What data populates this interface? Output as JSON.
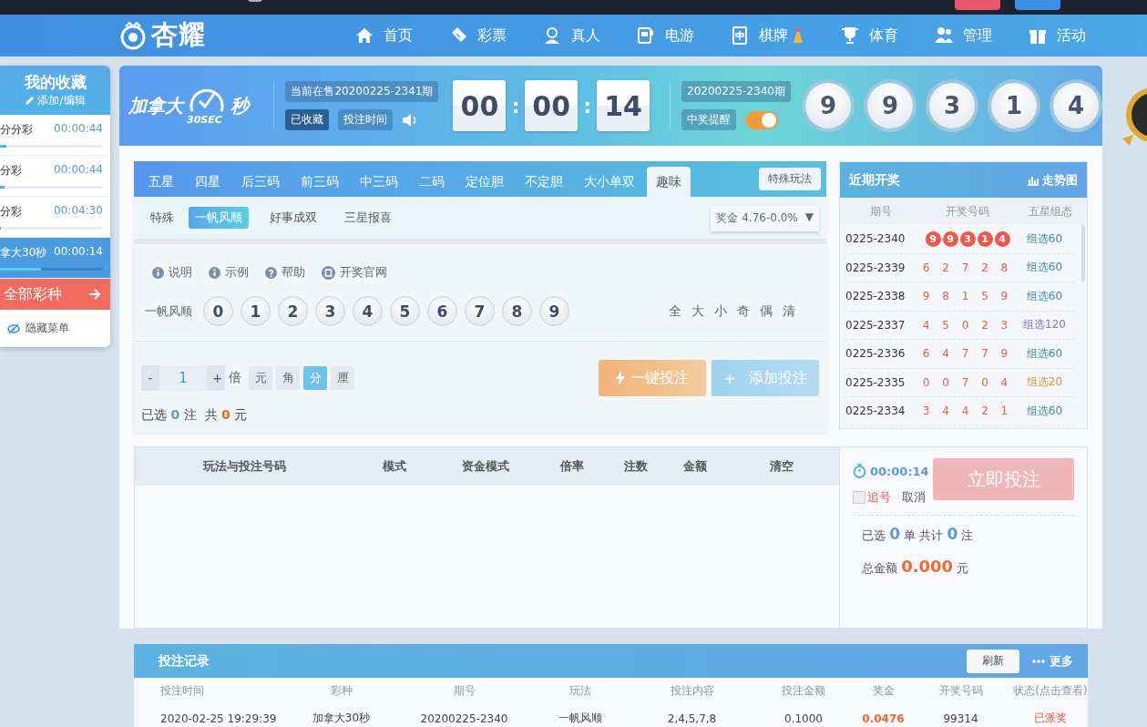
{
  "top_bar": {
    "buttons": [
      {
        "color": "#e8566b"
      },
      {
        "color": "#3a8fe6"
      }
    ]
  },
  "nav": {
    "logo": "杏耀",
    "items": [
      {
        "label": "首页"
      },
      {
        "label": "彩票"
      },
      {
        "label": "真人"
      },
      {
        "label": "电游"
      },
      {
        "label": "棋牌"
      },
      {
        "label": "体育"
      },
      {
        "label": "管理"
      },
      {
        "label": "活动"
      }
    ]
  },
  "favorites": {
    "title": "我的收藏",
    "edit": "添加/编辑",
    "items": [
      {
        "name": "分分彩",
        "time": "00:00:44",
        "level": 0.06,
        "selected": false
      },
      {
        "name": "分彩",
        "time": "00:00:44",
        "level": 0.04,
        "selected": false
      },
      {
        "name": "分彩",
        "time": "00:04:30",
        "level": 0.01,
        "selected": false
      },
      {
        "name": "拿大30秒",
        "time": "00:00:14",
        "level": 0.4,
        "selected": true
      }
    ],
    "all_lotteries": "全部彩种",
    "hide_menu": "隐藏菜单"
  },
  "lottery": {
    "name_left": "加拿大",
    "clock_text": "30SEC",
    "name_right": "秒",
    "current_issue": "当前在售20200225-2341期",
    "favorited": "已收藏",
    "bet_time": "投注时间",
    "countdown": [
      "00",
      "00",
      "14"
    ],
    "separators": [
      ":",
      ":"
    ],
    "last_issue": "20200225-2340期",
    "win_alert": {
      "label": "中奖提醒",
      "on": true
    },
    "result": [
      "9",
      "9",
      "3",
      "1",
      "4"
    ]
  },
  "play": {
    "tabs": [
      {
        "label": "五星",
        "selected": false
      },
      {
        "label": "四星",
        "selected": false
      },
      {
        "label": "后三码",
        "selected": false
      },
      {
        "label": "前三码",
        "selected": false
      },
      {
        "label": "中三码",
        "selected": false
      },
      {
        "label": "二码",
        "selected": false
      },
      {
        "label": "定位胆",
        "selected": false
      },
      {
        "label": "不定胆",
        "selected": false
      },
      {
        "label": "大小单双",
        "selected": false
      },
      {
        "label": "趣味",
        "selected": true
      }
    ],
    "special_play": "特殊玩法",
    "group_label": "特殊",
    "sub_tabs": [
      {
        "label": "一帆风顺",
        "selected": true
      },
      {
        "label": "好事成双",
        "selected": false
      },
      {
        "label": "三星报喜",
        "selected": false
      }
    ],
    "prize": "奖金 4.76-0.0%",
    "prize_caret": "▼",
    "help_links": [
      "说明",
      "示例",
      "帮助",
      "开奖官网"
    ],
    "row_label": "一帆风顺",
    "numbers": [
      {
        "label": "0",
        "selected": false
      },
      {
        "label": "1",
        "selected": false
      },
      {
        "label": "2",
        "selected": false
      },
      {
        "label": "3",
        "selected": false
      },
      {
        "label": "4",
        "selected": false
      },
      {
        "label": "5",
        "selected": false
      },
      {
        "label": "6",
        "selected": false
      },
      {
        "label": "7",
        "selected": false
      },
      {
        "label": "8",
        "selected": false
      },
      {
        "label": "9",
        "selected": false
      }
    ],
    "quick_picks": [
      "全",
      "大",
      "小",
      "奇",
      "偶",
      "清"
    ],
    "multiplier": {
      "minus": "-",
      "value": "1",
      "plus": "+",
      "unit": "倍"
    },
    "units": [
      {
        "label": "元",
        "selected": false
      },
      {
        "label": "角",
        "selected": false
      },
      {
        "label": "分",
        "selected": true
      },
      {
        "label": "厘",
        "selected": false
      }
    ],
    "summary": {
      "selected_label": "已选",
      "count": "0",
      "count_unit": "注",
      "total_label": "共",
      "amount": "0",
      "amount_unit": "元"
    },
    "quick_bet": "一键投注",
    "add_bet": {
      "symbol": "+",
      "label": "添加投注"
    }
  },
  "recent_draws": {
    "title": "近期开奖",
    "trend": "走势图",
    "columns": [
      "期号",
      "开奖号码",
      "五星组态"
    ],
    "rows": [
      {
        "period": "0225-2340",
        "numbers": [
          "9",
          "9",
          "3",
          "1",
          "4"
        ],
        "latest": true,
        "pattern": "组选60",
        "color": "#3b8fa3"
      },
      {
        "period": "0225-2339",
        "numbers": [
          "6",
          "2",
          "7",
          "2",
          "8"
        ],
        "latest": false,
        "pattern": "组选60",
        "color": "#3b8fa3"
      },
      {
        "period": "0225-2338",
        "numbers": [
          "9",
          "8",
          "1",
          "5",
          "9"
        ],
        "latest": false,
        "pattern": "组选60",
        "color": "#3b8fa3"
      },
      {
        "period": "0225-2337",
        "numbers": [
          "4",
          "5",
          "0",
          "2",
          "3"
        ],
        "latest": false,
        "pattern": "组选120",
        "color": "#8b6fd0"
      },
      {
        "period": "0225-2336",
        "numbers": [
          "6",
          "4",
          "7",
          "7",
          "9"
        ],
        "latest": false,
        "pattern": "组选60",
        "color": "#3b8fa3"
      },
      {
        "period": "0225-2335",
        "numbers": [
          "0",
          "0",
          "7",
          "0",
          "4"
        ],
        "latest": false,
        "pattern": "组选20",
        "color": "#c9962e"
      },
      {
        "period": "0225-2334",
        "numbers": [
          "3",
          "4",
          "4",
          "2",
          "1"
        ],
        "latest": false,
        "pattern": "组选60",
        "color": "#3b8fa3"
      }
    ]
  },
  "bet_list": {
    "columns": [
      "玩法与投注号码",
      "模式",
      "资金模式",
      "倍率",
      "注数",
      "金额",
      "清空"
    ],
    "timer": "00:00:14",
    "submit": "立即投注",
    "submit_disabled": true,
    "chase": {
      "label": "追号",
      "checked": false
    },
    "cancel": "取消",
    "summary": {
      "orders_label": "已选",
      "orders": "0",
      "orders_unit": "单",
      "count_label": "共计",
      "count": "0",
      "count_unit": "注",
      "total_label": "总金额",
      "total": "0.000",
      "total_unit": "元"
    }
  },
  "records": {
    "title": "投注记录",
    "refresh": "刷新",
    "more": "更多",
    "columns": [
      "投注时间",
      "彩种",
      "期号",
      "玩法",
      "投注内容",
      "投注金额",
      "奖金",
      "开奖号码",
      "状态(点击查看)"
    ],
    "rows": [
      {
        "cells": [
          "2020-02-25 19:29:39",
          "加拿大30秒",
          "20200225-2340",
          "一帆风顺",
          "2,4,5,7,8",
          "0.1000",
          "0.0476",
          "99314",
          "已派奖"
        ]
      }
    ]
  }
}
